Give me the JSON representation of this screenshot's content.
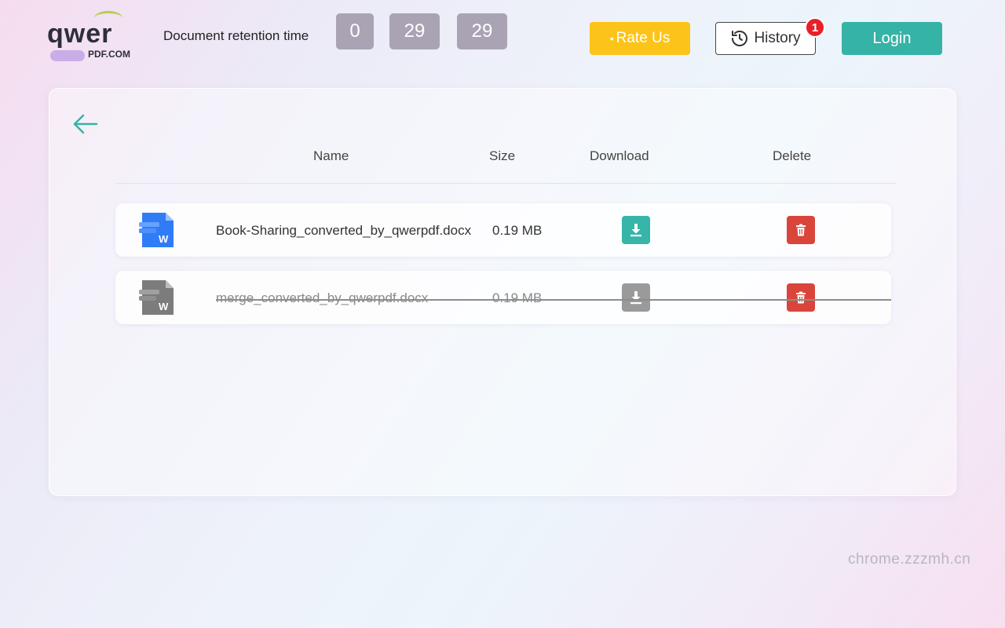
{
  "header": {
    "logo": {
      "word": "qwer",
      "sub": "PDF.COM"
    },
    "retention_label": "Document retention time",
    "timer": [
      "0",
      "29",
      "29"
    ],
    "rate_label": "Rate Us",
    "history_label": "History",
    "history_badge": "1",
    "login_label": "Login"
  },
  "table": {
    "columns": {
      "name": "Name",
      "size": "Size",
      "download": "Download",
      "delete": "Delete"
    },
    "rows": [
      {
        "name": "Book-Sharing_converted_by_qwerpdf.docx",
        "size": "0.19 MB",
        "state": "active",
        "icon": "word-file-icon"
      },
      {
        "name": "merge_converted_by_qwerpdf.docx",
        "size": "0.19 MB",
        "state": "deleted",
        "icon": "word-file-icon"
      }
    ]
  },
  "watermark": "chrome.zzzmh.cn",
  "colors": {
    "accent": "#36b3a7",
    "rate": "#fcc419",
    "delete": "#d9453b",
    "badge": "#e8202a",
    "disabled": "#9a9a9a"
  },
  "icons": {
    "back": "arrow-left-icon",
    "history": "history-clock-icon",
    "download": "download-icon",
    "delete": "trash-icon"
  }
}
